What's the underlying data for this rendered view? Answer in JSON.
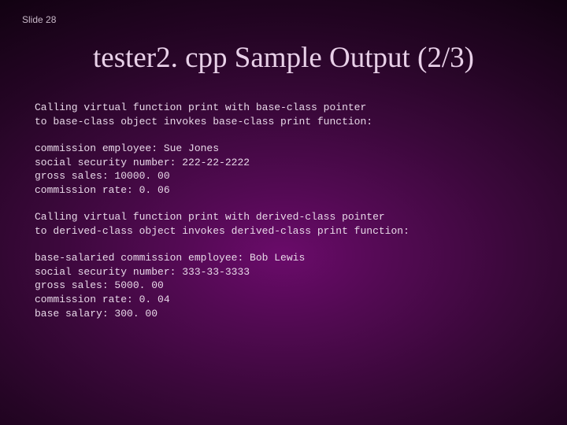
{
  "slide_label": "Slide 28",
  "title": "tester2. cpp Sample Output (2/3)",
  "blocks": {
    "b1": "Calling virtual function print with base-class pointer\nto base-class object invokes base-class print function:",
    "b2": "commission employee: Sue Jones\nsocial security number: 222-22-2222\ngross sales: 10000. 00\ncommission rate: 0. 06",
    "b3": "Calling virtual function print with derived-class pointer\nto derived-class object invokes derived-class print function:",
    "b4": "base-salaried commission employee: Bob Lewis\nsocial security number: 333-33-3333\ngross sales: 5000. 00\ncommission rate: 0. 04\nbase salary: 300. 00"
  }
}
